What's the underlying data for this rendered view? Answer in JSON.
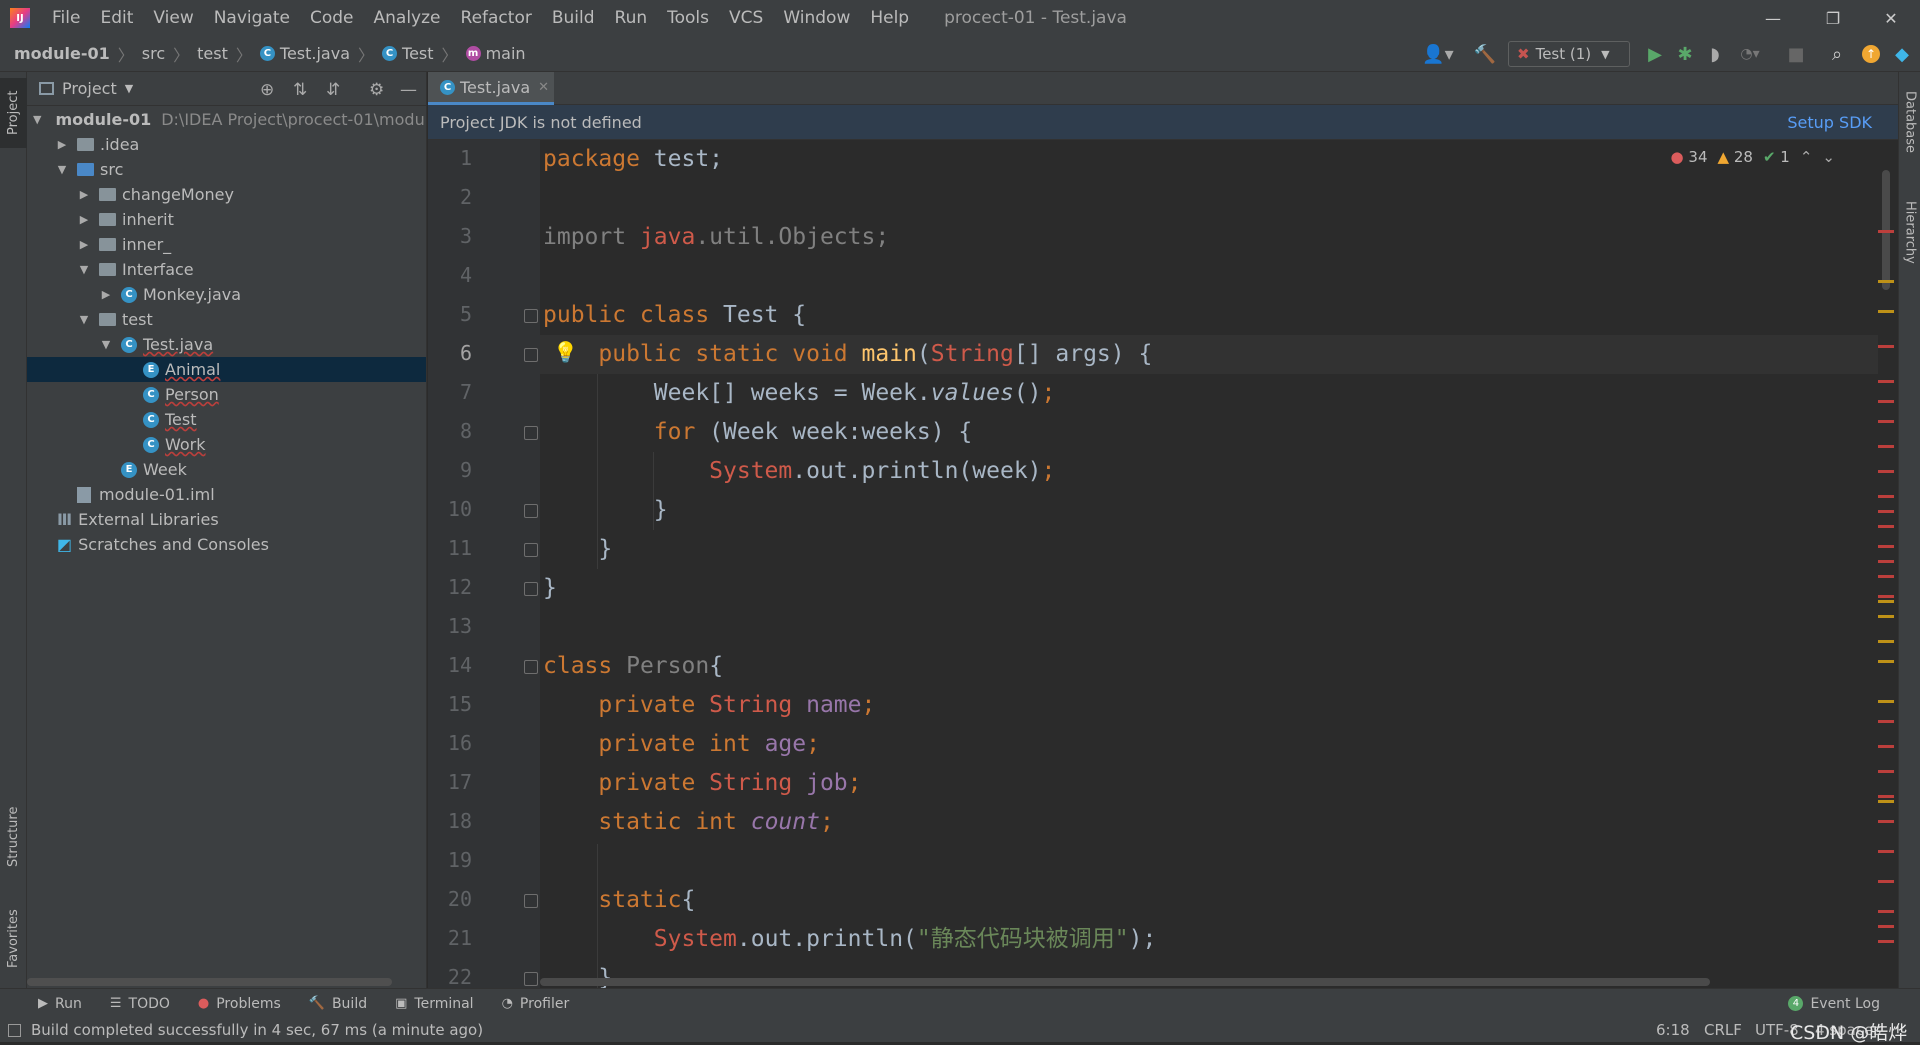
{
  "window": {
    "title": "procect-01 - Test.java",
    "app_icon": "IJ"
  },
  "menu": [
    "File",
    "Edit",
    "View",
    "Navigate",
    "Code",
    "Analyze",
    "Refactor",
    "Build",
    "Run",
    "Tools",
    "VCS",
    "Window",
    "Help"
  ],
  "breadcrumb": [
    "module-01",
    "src",
    "test",
    "Test.java",
    "Test",
    "main"
  ],
  "run_config": {
    "label": "Test (1)"
  },
  "project_panel": {
    "title": "Project",
    "tree": [
      {
        "label": "module-01",
        "extra": "D:\\IDEA Project\\procect-01\\module-01"
      },
      {
        "label": ".idea"
      },
      {
        "label": "src"
      },
      {
        "label": "changeMoney"
      },
      {
        "label": "inherit"
      },
      {
        "label": "inner_"
      },
      {
        "label": "Interface"
      },
      {
        "label": "Monkey.java"
      },
      {
        "label": "test"
      },
      {
        "label": "Test.java"
      },
      {
        "label": "Animal"
      },
      {
        "label": "Person"
      },
      {
        "label": "Test"
      },
      {
        "label": "Work"
      },
      {
        "label": "Week"
      },
      {
        "label": "module-01.iml"
      },
      {
        "label": "External Libraries"
      },
      {
        "label": "Scratches and Consoles"
      }
    ]
  },
  "side_tabs": {
    "project": "Project",
    "structure": "Structure",
    "favorites": "Favorites",
    "database": "Database",
    "hierarchy": "Hierarchy"
  },
  "editor": {
    "tab": "Test.java",
    "notice": "Project JDK is not defined",
    "notice_action": "Setup SDK",
    "inspections": {
      "errors": "34",
      "warnings": "28",
      "ok": "1"
    },
    "line_numbers": [
      "1",
      "2",
      "3",
      "4",
      "5",
      "6",
      "7",
      "8",
      "9",
      "10",
      "11",
      "12",
      "13",
      "14",
      "15",
      "16",
      "17",
      "18",
      "19",
      "20",
      "21",
      "22"
    ],
    "code": {
      "l1a": "package",
      "l1b": " test;",
      "l3a": "import ",
      "l3b": "java",
      ".l3c": ".util.Objects;",
      "l3c": ".util.Objects;",
      "l5a": "public class",
      "l5b": " Test {",
      "l6a": "    public static void ",
      "l6b": "main",
      "l6c": "(",
      "l6d": "String",
      "l6e": "[] args) {",
      "l7a": "        Week[] weeks = Week.",
      "l7b": "values",
      "l7c": "()",
      ";l7d": ";",
      "l7d": ";",
      "l8a": "        for ",
      "l8b": "(Week week:weeks) {",
      "l9a": "            ",
      "l9b": "System",
      ".l9c": ".",
      "l9c": ".out.println(week)",
      "l9d": ";",
      "l10": "        }",
      "l11": "    }",
      "l12": "}",
      "l14a": "class ",
      "l14b": "Person",
      "l14c": "{",
      "l15a": "    private ",
      "l15b": "String ",
      "l15c": "name",
      ";l15d": ";",
      "l15d": ";",
      "l16a": "    private int ",
      "l16b": "age",
      "l16c": ";",
      "l17a": "    private ",
      "l17b": "String ",
      "l17c": "job",
      "l17d": ";",
      "l18a": "    static int ",
      "l18b": "count",
      "l18c": ";",
      "l20a": "    static",
      "l20b": "{",
      "l21a": "        ",
      "l21b": "System",
      "l21c": ".out.println(",
      "l21d": "\"静态代码块被调用\"",
      "l21e": ");",
      "l22": "    }"
    }
  },
  "toolwindows": [
    "Run",
    "TODO",
    "Problems",
    "Build",
    "Terminal",
    "Profiler"
  ],
  "event_log": {
    "count": "4",
    "label": "Event Log"
  },
  "status": {
    "message": "Build completed successfully in 4 sec, 67 ms (a minute ago)",
    "position": "6:18",
    "line_sep": "CRLF",
    "encoding": "UTF-8",
    "indent": "4 spaces",
    "watermark": "CSDN @皓烨"
  }
}
